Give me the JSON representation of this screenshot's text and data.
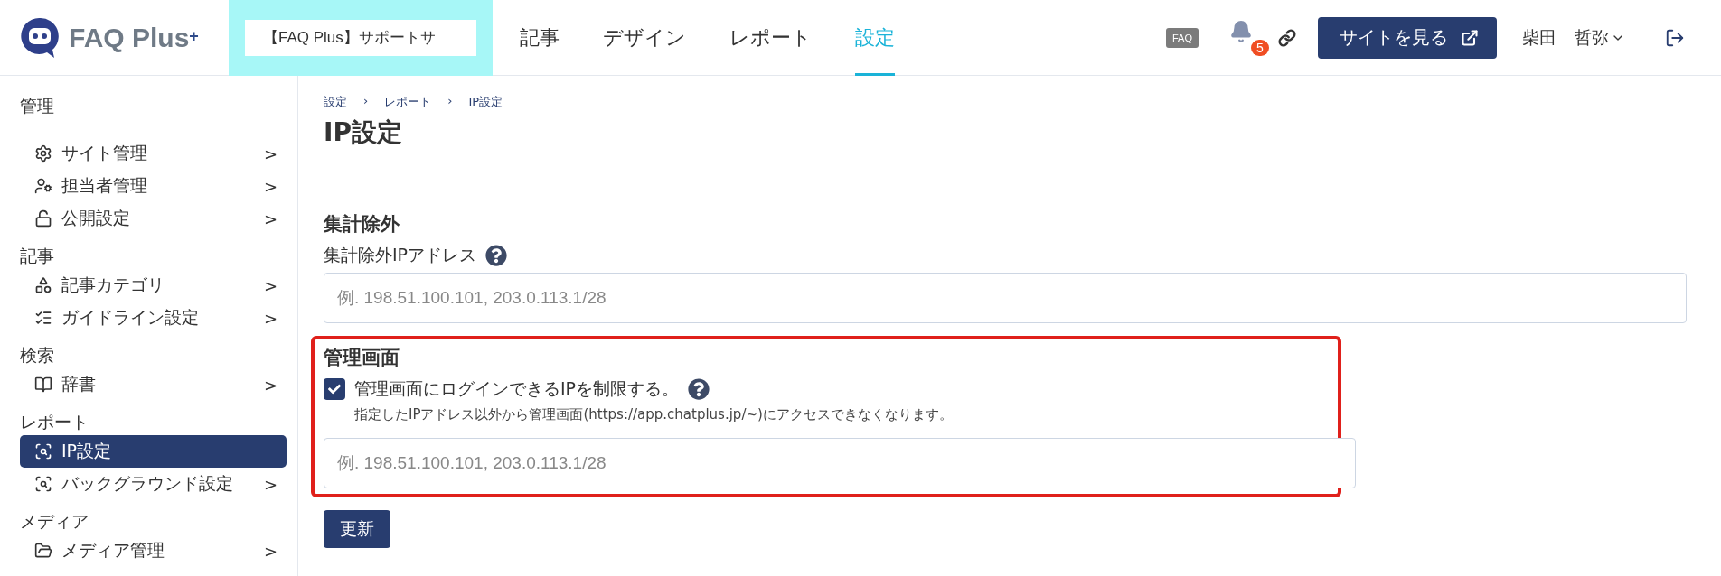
{
  "header": {
    "logo": {
      "text": "FAQ Plus",
      "mark": "+"
    },
    "site_selector": {
      "value": "【FAQ Plus】サポートサ"
    },
    "nav": [
      {
        "label": "記事",
        "selected": false
      },
      {
        "label": "デザイン",
        "selected": false
      },
      {
        "label": "レポート",
        "selected": false
      },
      {
        "label": "設定",
        "selected": true
      }
    ],
    "faq_badge": "FAQ",
    "notification_count": "5",
    "view_site_button": "サイトを見る",
    "user": {
      "last_name": "柴田",
      "first_name": "哲弥"
    }
  },
  "sidebar": [
    {
      "heading": "管理",
      "items": [
        {
          "label": "サイト管理",
          "arrow": ">",
          "selected": false
        },
        {
          "label": "担当者管理",
          "arrow": ">",
          "selected": false
        },
        {
          "label": "公開設定",
          "arrow": ">",
          "selected": false
        }
      ]
    },
    {
      "heading": "記事",
      "items": [
        {
          "label": "記事カテゴリ",
          "arrow": ">",
          "selected": false
        },
        {
          "label": "ガイドライン設定",
          "arrow": ">",
          "selected": false
        }
      ]
    },
    {
      "heading": "検索",
      "items": [
        {
          "label": "辞書",
          "arrow": ">",
          "selected": false
        }
      ]
    },
    {
      "heading": "レポート",
      "items": [
        {
          "label": "IP設定",
          "selected": true
        },
        {
          "label": "バックグラウンド設定",
          "arrow": ">",
          "selected": false
        }
      ]
    },
    {
      "heading": "メディア",
      "items": [
        {
          "label": "メディア管理",
          "arrow": ">",
          "selected": false
        }
      ]
    }
  ],
  "breadcrumb": [
    "設定",
    "レポート",
    "IP設定"
  ],
  "breadcrumb_separator": "›",
  "title": "IP設定",
  "sections": [
    {
      "heading": "集計除外",
      "label": "集計除外IPアドレス",
      "placeholder": "例. 198.51.100.101, 203.0.113.1/28",
      "highlighted": false
    },
    {
      "heading": "管理画面",
      "checkbox": {
        "label": "管理画面にログインできるIPを制限する。",
        "checked": true
      },
      "help": "指定したIPアドレス以外から管理画面(https://app.chatplus.jp/~)にアクセスできなくなります。",
      "placeholder": "例. 198.51.100.101, 203.0.113.1/28",
      "highlighted": true
    }
  ],
  "submit_button": "更新"
}
